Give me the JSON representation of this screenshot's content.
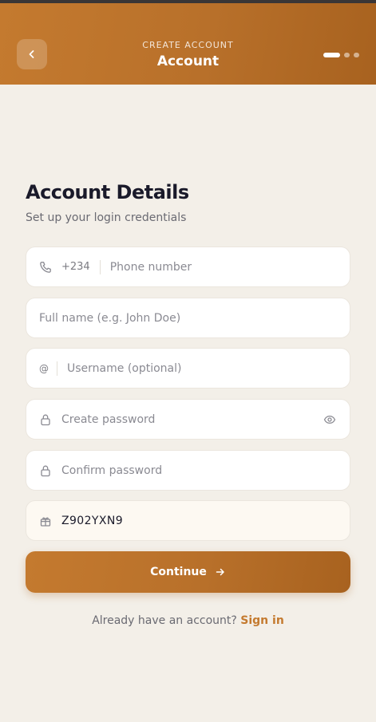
{
  "header": {
    "eyebrow": "CREATE ACCOUNT",
    "title": "Account",
    "back_icon": "chevron-left-icon",
    "steps_total": 3,
    "step_current": 1
  },
  "content": {
    "title": "Account Details",
    "subtitle": "Set up your login credentials"
  },
  "form": {
    "phone": {
      "icon": "phone-icon",
      "prefix": "+234",
      "placeholder": "Phone number",
      "value": ""
    },
    "full_name": {
      "placeholder": "Full name (e.g. John Doe)",
      "value": ""
    },
    "username": {
      "prefix": "@",
      "placeholder": "Username (optional)",
      "value": ""
    },
    "password": {
      "icon": "lock-icon",
      "placeholder": "Create password",
      "value": "",
      "toggle_icon": "eye-icon"
    },
    "confirm_password": {
      "icon": "lock-icon",
      "placeholder": "Confirm password",
      "value": ""
    },
    "referral": {
      "icon": "gift-icon",
      "placeholder": "",
      "value": "Z902YXN9"
    }
  },
  "actions": {
    "continue_label": "Continue",
    "continue_icon": "arrow-right-icon",
    "signin_prompt": "Already have an account?",
    "signin_link": "Sign in"
  },
  "colors": {
    "accent": "#c47a2f",
    "accent_dark": "#a8621f",
    "background": "#f3efe8",
    "text_primary": "#1a1a2a",
    "text_muted": "#6a6a72"
  }
}
